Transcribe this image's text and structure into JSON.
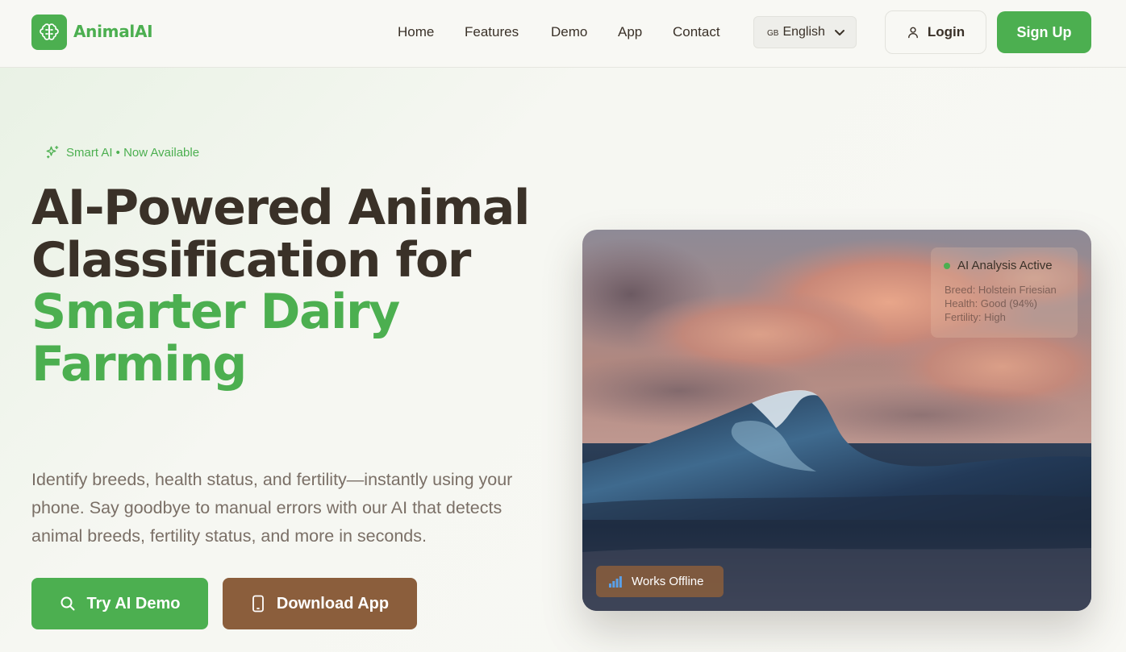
{
  "brand": {
    "name": "AnimalAI",
    "color": "#4caf50"
  },
  "nav": {
    "items": [
      "Home",
      "Features",
      "Demo",
      "App",
      "Contact"
    ],
    "language": {
      "flag": "GB",
      "selected": "English"
    },
    "login_label": "Login",
    "signup_label": "Sign Up"
  },
  "hero": {
    "badge": "Smart AI • Now Available",
    "headline_dark": "AI-Powered Animal Classification for",
    "headline_green": "Smarter Dairy Farming",
    "subtext": "Identify breeds, health status, and fertility—instantly using your phone. Say goodbye to manual errors with our AI that detects animal breeds, fertility status, and more in seconds.",
    "primary_cta": "Try AI Demo",
    "secondary_cta": "Download App"
  },
  "card": {
    "status_title": "AI Analysis Active",
    "status_lines": [
      "Breed: Holstein Friesian",
      "Health: Good (94%)",
      "Fertility: High"
    ],
    "offline_label": "Works Offline"
  },
  "colors": {
    "accent": "#4caf50",
    "brown": "#8b5e3c",
    "text_dark": "#3a3128",
    "text_muted": "#7a6f66"
  },
  "icons": [
    "brain-icon",
    "sparkle-icon",
    "chevron-down-icon",
    "user-icon",
    "search-icon",
    "phone-icon",
    "signal-icon"
  ]
}
